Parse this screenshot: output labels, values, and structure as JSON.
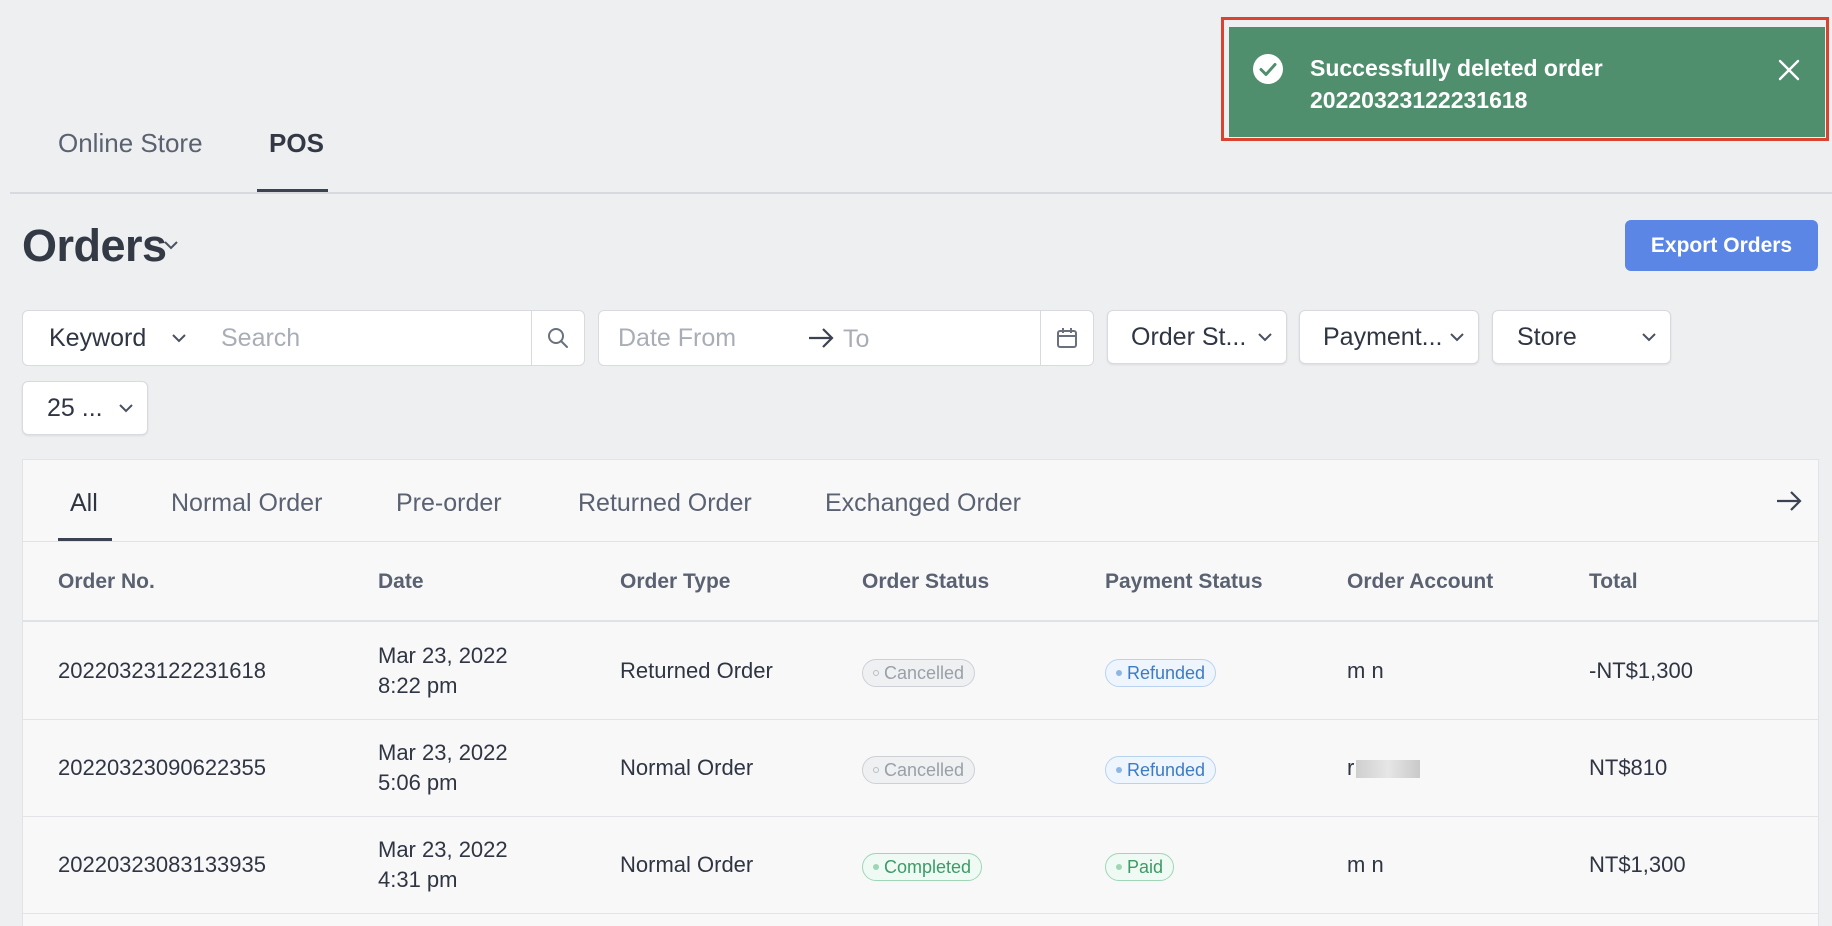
{
  "channel_tabs": [
    {
      "label": "Online Store"
    },
    {
      "label": "POS",
      "active": true
    }
  ],
  "page": {
    "title": "Orders",
    "export_label": "Export Orders"
  },
  "filters": {
    "keyword_select": "Keyword",
    "search_placeholder": "Search",
    "date_from_placeholder": "Date From",
    "date_to_placeholder": "To",
    "order_status": "Order St...",
    "payment_status": "Payment...",
    "store": "Store",
    "page_size": "25 ..."
  },
  "order_tabs": [
    "All",
    "Normal Order",
    "Pre-order",
    "Returned Order",
    "Exchanged Order"
  ],
  "table": {
    "headers": [
      "Order No.",
      "Date",
      "Order Type",
      "Order Status",
      "Payment Status",
      "Order Account",
      "Total"
    ],
    "rows": [
      {
        "order_no": "20220323122231618",
        "date": "Mar 23, 2022",
        "time": "8:22 pm",
        "type": "Returned Order",
        "status": "Cancelled",
        "payment": "Refunded",
        "account": "m n",
        "total": "-NT$1,300"
      },
      {
        "order_no": "20220323090622355",
        "date": "Mar 23, 2022",
        "time": "5:06 pm",
        "type": "Normal Order",
        "status": "Cancelled",
        "payment": "Refunded",
        "account": "r",
        "total": "NT$810"
      },
      {
        "order_no": "20220323083133935",
        "date": "Mar 23, 2022",
        "time": "4:31 pm",
        "type": "Normal Order",
        "status": "Completed",
        "payment": "Paid",
        "account": "m n",
        "total": "NT$1,300"
      }
    ]
  },
  "toast": {
    "line1": "Successfully deleted order",
    "line2": "20220323122231618",
    "color": "#4f8f6d"
  },
  "colors": {
    "accent": "#5b86e5",
    "toast_highlight": "#d9432f"
  },
  "icons": [
    "chevron-down-icon",
    "search-icon",
    "calendar-icon",
    "arrow-right-icon",
    "check-circle-icon",
    "close-icon"
  ]
}
